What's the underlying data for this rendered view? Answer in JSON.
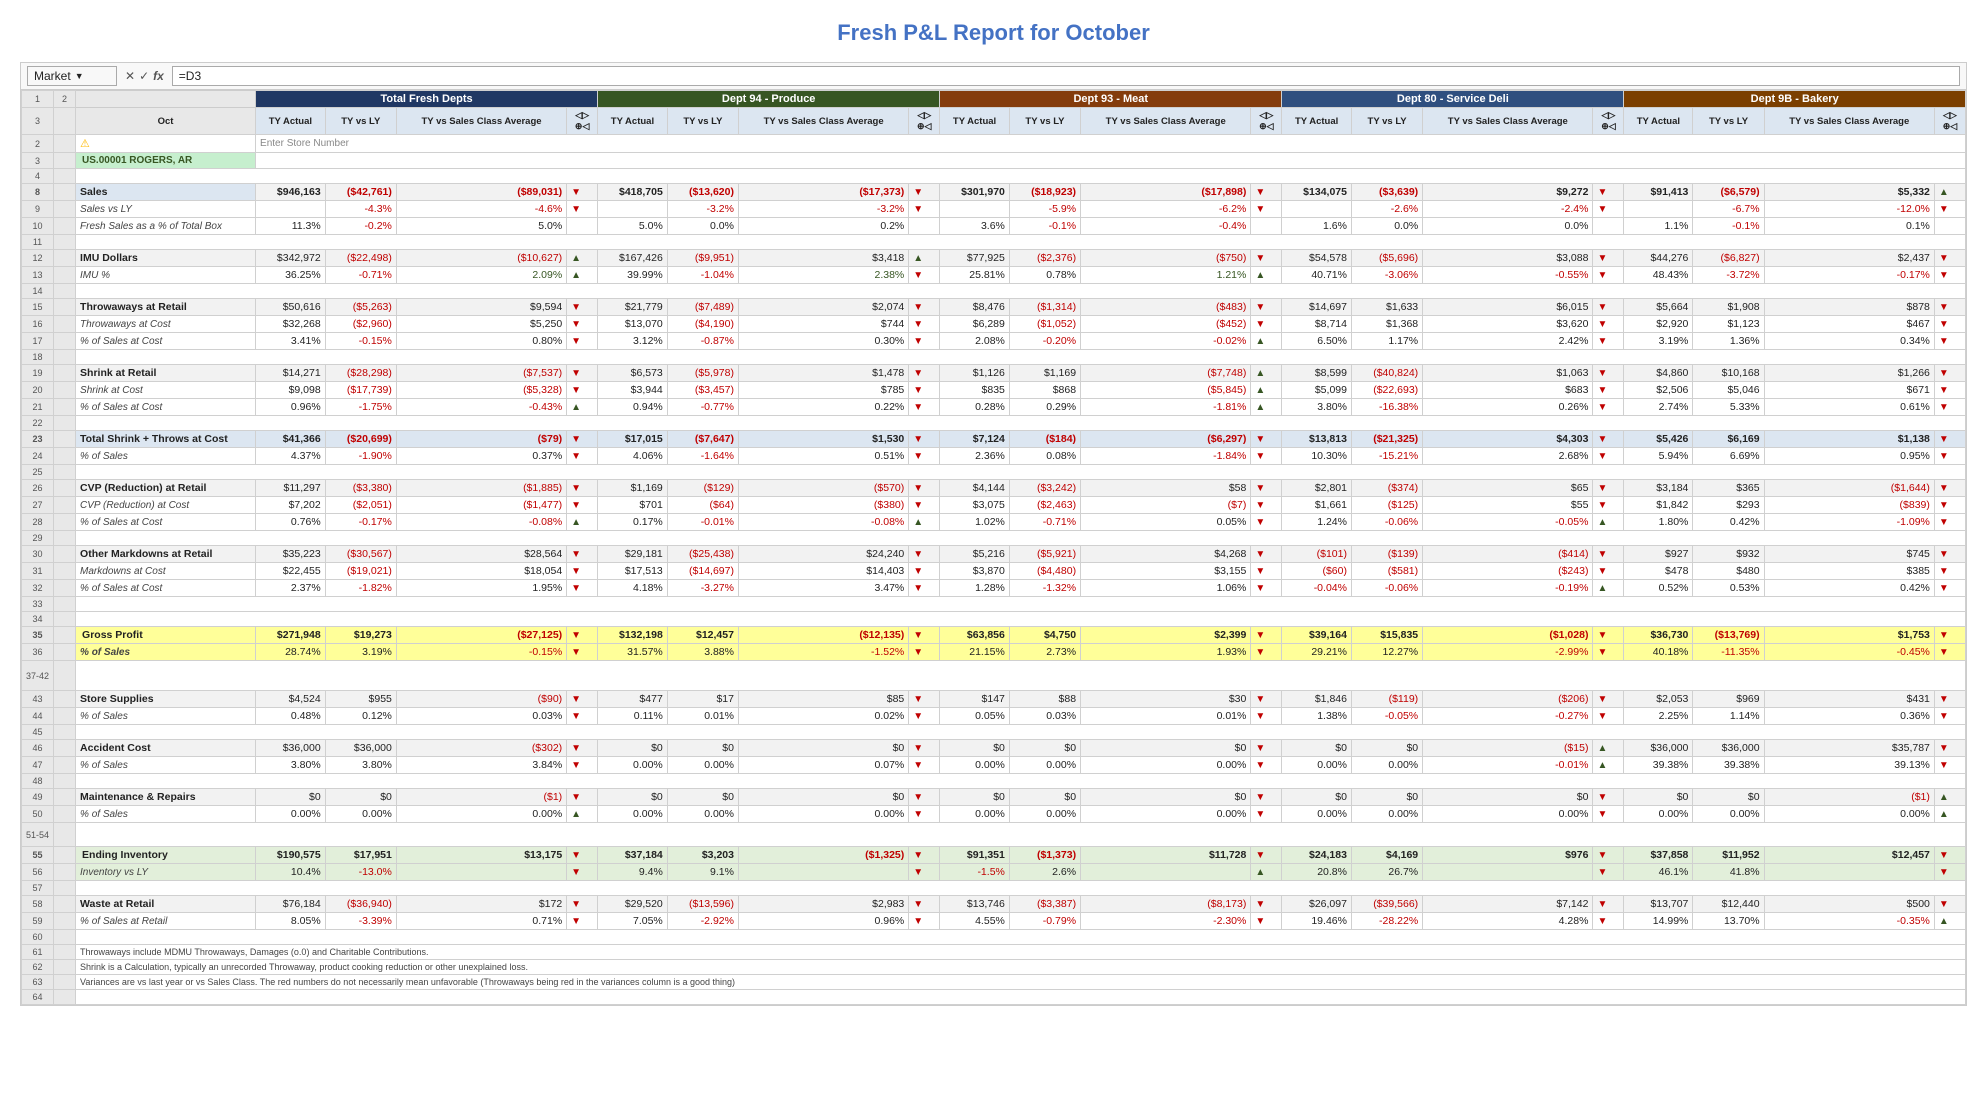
{
  "title": "Fresh P&L Report for October",
  "formula_bar": {
    "name_box": "Market",
    "formula": "=D3"
  },
  "store": "US.00001 ROGERS, AR",
  "col_month": "Oct",
  "sections": {
    "total_fresh": "Total Fresh Depts",
    "dept94": "Dept 94 - Produce",
    "dept93": "Dept 93 - Meat",
    "dept80": "Dept 80 - Service Deli",
    "dept98": "Dept 9B - Bakery"
  },
  "col_headers": [
    "TY Actual",
    "TY vs LY",
    "TY vs Sales Class Average",
    "▼"
  ],
  "rows": [
    {
      "rn": 8,
      "label": "Sales",
      "type": "section-hdr",
      "vals": [
        [
          "$946,163",
          "($42,761)",
          "($89,031)",
          "▼"
        ],
        [
          "$418,705",
          "($13,620)",
          "($17,373)",
          "▼"
        ],
        [
          "$301,970",
          "($18,923)",
          "($17,898)",
          "▼"
        ],
        [
          "$134,075",
          "($3,639)",
          "$9,272",
          "▼"
        ],
        [
          "$91,413",
          "($6,579)",
          "$5,332",
          "▲"
        ]
      ]
    },
    {
      "rn": 9,
      "label": "Sales vs LY",
      "type": "sub",
      "vals": [
        [
          "-4.3%",
          "-4.6%",
          "▼"
        ],
        [
          "-3.2%",
          "-3.2%",
          "▼"
        ],
        [
          "-5.9%",
          "-6.2%",
          "▼"
        ],
        [
          "-2.6%",
          "-2.4%",
          "▼"
        ],
        [
          "-6.7%",
          "-12.0%",
          "▼"
        ]
      ]
    },
    {
      "rn": 10,
      "label": "Fresh Sales as a % of Total Box",
      "type": "sub",
      "vals": [
        [
          "11.3%",
          "-0.2%",
          "5.0%"
        ],
        [
          "5.0%",
          "0.0%",
          "0.2%"
        ],
        [
          "3.6%",
          "-0.1%",
          "-0.4%"
        ],
        [
          "1.6%",
          "0.0%",
          "0.0%"
        ],
        [
          "1.1%",
          "-0.1%",
          "0.1%"
        ]
      ]
    },
    {
      "rn": 12,
      "label": "IMU Dollars",
      "type": "label",
      "vals": [
        [
          "$342,972",
          "($22,498)",
          "($10,627)",
          "▲"
        ],
        [
          "$167,426",
          "($9,951)",
          "$3,418",
          "▲"
        ],
        [
          "$77,925",
          "($2,376)",
          "($750)",
          "▼"
        ],
        [
          "$54,578",
          "($5,696)",
          "$3,088",
          "▼"
        ],
        [
          "$44,276",
          "($6,827)",
          "$2,437",
          "▼"
        ]
      ]
    },
    {
      "rn": 13,
      "label": "IMU %",
      "type": "sub",
      "vals": [
        [
          "36.25%",
          "-0.71%",
          "2.09%",
          "▲"
        ],
        [
          "39.99%",
          "-1.04%",
          "2.38%",
          "▼"
        ],
        [
          "25.81%",
          "0.78%",
          "1.21%",
          "▲"
        ],
        [
          "40.71%",
          "-3.06%",
          "-0.55%",
          "▼"
        ],
        [
          "48.43%",
          "-3.72%",
          "-0.17%",
          "▼"
        ]
      ]
    },
    {
      "rn": 15,
      "label": "Throwaways at Retail",
      "type": "label",
      "vals": [
        [
          "$50,616",
          "($5,263)",
          "$9,594",
          "▼"
        ],
        [
          "$21,779",
          "($7,489)",
          "$2,074",
          "▼"
        ],
        [
          "$8,476",
          "($1,314)",
          "($483)",
          "▼"
        ],
        [
          "$14,697",
          "$1,633",
          "$6,015",
          "▼"
        ],
        [
          "$5,664",
          "$1,908",
          "$878",
          "▼"
        ]
      ]
    },
    {
      "rn": 16,
      "label": "Throwaways at Cost",
      "type": "sub",
      "vals": [
        [
          "$32,268",
          "($2,960)",
          "$5,250",
          "▼"
        ],
        [
          "$13,070",
          "($4,190)",
          "$744",
          "▼"
        ],
        [
          "$6,289",
          "($1,052)",
          "($452)",
          "▼"
        ],
        [
          "$8,714",
          "$1,368",
          "$3,620",
          "▼"
        ],
        [
          "$2,920",
          "$1,123",
          "$467",
          "▼"
        ]
      ]
    },
    {
      "rn": 17,
      "label": "% of Sales at Cost",
      "type": "sub",
      "vals": [
        [
          "3.41%",
          "-0.15%",
          "0.80%",
          "▼"
        ],
        [
          "3.12%",
          "-0.87%",
          "0.30%",
          "▼"
        ],
        [
          "2.08%",
          "-0.20%",
          "-0.02%",
          "▲"
        ],
        [
          "6.50%",
          "1.17%",
          "2.42%",
          "▼"
        ],
        [
          "3.19%",
          "1.36%",
          "0.34%",
          "▼"
        ]
      ]
    },
    {
      "rn": 19,
      "label": "Shrink at Retail",
      "type": "label",
      "vals": [
        [
          "$14,271",
          "($28,298)",
          "($7,537)",
          "▼"
        ],
        [
          "$6,573",
          "($5,978)",
          "$1,478",
          "▼"
        ],
        [
          "$1,126",
          "$1,169",
          "($7,748)",
          "▲"
        ],
        [
          "$8,599",
          "($40,824)",
          "$1,063",
          "▼"
        ],
        [
          "$4,860",
          "$10,168",
          "$1,266",
          "▼"
        ]
      ]
    },
    {
      "rn": 20,
      "label": "Shrink at Cost",
      "type": "sub",
      "vals": [
        [
          "$9,098",
          "($17,739)",
          "($5,328)",
          "▼"
        ],
        [
          "$3,944",
          "($3,457)",
          "$785",
          "▼"
        ],
        [
          "$835",
          "$868",
          "($5,845)",
          "▲"
        ],
        [
          "$5,099",
          "($22,693)",
          "$683",
          "▼"
        ],
        [
          "$2,506",
          "$5,046",
          "$671",
          "▼"
        ]
      ]
    },
    {
      "rn": 21,
      "label": "% of Sales at Cost",
      "type": "sub",
      "vals": [
        [
          "0.96%",
          "-1.75%",
          "-0.43%",
          "▲"
        ],
        [
          "0.94%",
          "-0.77%",
          "0.22%",
          "▼"
        ],
        [
          "0.28%",
          "0.29%",
          "-1.81%",
          "▲"
        ],
        [
          "3.80%",
          "-16.38%",
          "0.26%",
          "▼"
        ],
        [
          "2.74%",
          "5.33%",
          "0.61%",
          "▼"
        ]
      ]
    },
    {
      "rn": 23,
      "label": "Total Shrink + Throws at Cost",
      "type": "total-row",
      "vals": [
        [
          "$41,366",
          "($20,699)",
          "($79)",
          "▼"
        ],
        [
          "$17,015",
          "($7,647)",
          "$1,530",
          "▼"
        ],
        [
          "$7,124",
          "($184)",
          "($6,297)",
          "▼"
        ],
        [
          "$13,813",
          "($21,325)",
          "$4,303",
          "▼"
        ],
        [
          "$5,426",
          "$6,169",
          "$1,138",
          "▼"
        ]
      ]
    },
    {
      "rn": 24,
      "label": "% of Sales",
      "type": "sub",
      "vals": [
        [
          "4.37%",
          "-1.90%",
          "0.37%",
          "▼"
        ],
        [
          "4.06%",
          "-1.64%",
          "0.51%",
          "▼"
        ],
        [
          "2.36%",
          "0.08%",
          "-1.84%",
          "▼"
        ],
        [
          "10.30%",
          "-15.21%",
          "2.68%",
          "▼"
        ],
        [
          "5.94%",
          "6.69%",
          "0.95%",
          "▼"
        ]
      ]
    },
    {
      "rn": 26,
      "label": "CVP (Reduction) at Retail",
      "type": "label",
      "vals": [
        [
          "$11,297",
          "($3,380)",
          "($1,885)",
          "▼"
        ],
        [
          "$1,169",
          "($129)",
          "($570)",
          "▼"
        ],
        [
          "$4,144",
          "($3,242)",
          "$58",
          "▼"
        ],
        [
          "$2,801",
          "($374)",
          "$65",
          "▼"
        ],
        [
          "$3,184",
          "$365",
          "($1,644)",
          "▼"
        ]
      ]
    },
    {
      "rn": 27,
      "label": "CVP (Reduction) at Cost",
      "type": "sub",
      "vals": [
        [
          "$7,202",
          "($2,051)",
          "($1,477)",
          "▼"
        ],
        [
          "$701",
          "($64)",
          "($380)",
          "▼"
        ],
        [
          "$3,075",
          "($2,463)",
          "($7)",
          "▼"
        ],
        [
          "$1,661",
          "($125)",
          "$55",
          "▼"
        ],
        [
          "$1,842",
          "$293",
          "($839)",
          "▼"
        ]
      ]
    },
    {
      "rn": 28,
      "label": "% of Sales at Cost",
      "type": "sub",
      "vals": [
        [
          "0.76%",
          "-0.17%",
          "-0.08%",
          "▲"
        ],
        [
          "0.17%",
          "-0.01%",
          "-0.08%",
          "▲"
        ],
        [
          "1.02%",
          "-0.71%",
          "0.05%",
          "▼"
        ],
        [
          "1.24%",
          "-0.06%",
          "-0.05%",
          "▲"
        ],
        [
          "1.80%",
          "0.42%",
          "-1.09%",
          "▼"
        ]
      ]
    },
    {
      "rn": 30,
      "label": "Other Markdowns at Retail",
      "type": "label",
      "vals": [
        [
          "$35,223",
          "($30,567)",
          "$28,564",
          "▼"
        ],
        [
          "$29,181",
          "($25,438)",
          "$24,240",
          "▼"
        ],
        [
          "$5,216",
          "($5,921)",
          "$4,268",
          "▼"
        ],
        [
          "($101)",
          "($139)",
          "($414)",
          "▼"
        ],
        [
          "$927",
          "$932",
          "$745",
          "▼"
        ]
      ]
    },
    {
      "rn": 31,
      "label": "Markdowns at Cost",
      "type": "sub",
      "vals": [
        [
          "$22,455",
          "($19,021)",
          "$18,054",
          "▼"
        ],
        [
          "$17,513",
          "($14,697)",
          "$14,403",
          "▼"
        ],
        [
          "$3,870",
          "($4,480)",
          "$3,155",
          "▼"
        ],
        [
          "($60)",
          "($581)",
          "($243)",
          "▼"
        ],
        [
          "$478",
          "$480",
          "$385",
          "▼"
        ]
      ]
    },
    {
      "rn": 32,
      "label": "% of Sales at Cost",
      "type": "sub",
      "vals": [
        [
          "2.37%",
          "-1.82%",
          "1.95%",
          "▼"
        ],
        [
          "4.18%",
          "-3.27%",
          "3.47%",
          "▼"
        ],
        [
          "1.28%",
          "-1.32%",
          "1.06%",
          "▼"
        ],
        [
          "-0.04%",
          "-0.06%",
          "-0.19%",
          "▲"
        ],
        [
          "0.52%",
          "0.53%",
          "0.42%",
          "▼"
        ]
      ]
    },
    {
      "rn": 35,
      "label": "Gross Profit",
      "type": "gross",
      "vals": [
        [
          "$271,948",
          "$19,273",
          "($27,125)",
          "▼"
        ],
        [
          "$132,198",
          "$12,457",
          "($12,135)",
          "▼"
        ],
        [
          "$63,856",
          "$4,750",
          "$2,399",
          "▼"
        ],
        [
          "$39,164",
          "$15,835",
          "($1,028)",
          "▼"
        ],
        [
          "$36,730",
          "($13,769)",
          "$1,753",
          "▼"
        ]
      ]
    },
    {
      "rn": 36,
      "label": "% of Sales",
      "type": "gross-sub",
      "vals": [
        [
          "28.74%",
          "3.19%",
          "-0.15%",
          "▼"
        ],
        [
          "31.57%",
          "3.88%",
          "-1.52%",
          "▼"
        ],
        [
          "21.15%",
          "2.73%",
          "1.93%",
          "▼"
        ],
        [
          "29.21%",
          "12.27%",
          "-2.99%",
          "▼"
        ],
        [
          "40.18%",
          "-11.35%",
          "-0.45%",
          "▼"
        ]
      ]
    },
    {
      "rn": 43,
      "label": "Store Supplies",
      "type": "label",
      "vals": [
        [
          "$4,524",
          "$955",
          "($90)",
          "▼"
        ],
        [
          "$477",
          "$17",
          "$85",
          "▼"
        ],
        [
          "$147",
          "$88",
          "$30",
          "▼"
        ],
        [
          "$1,846",
          "($119)",
          "($206)",
          "▼"
        ],
        [
          "$2,053",
          "$969",
          "$431",
          "▼"
        ]
      ]
    },
    {
      "rn": 44,
      "label": "% of Sales",
      "type": "sub",
      "vals": [
        [
          "0.48%",
          "0.12%",
          "0.03%",
          "▼"
        ],
        [
          "0.11%",
          "0.01%",
          "0.02%",
          "▼"
        ],
        [
          "0.05%",
          "0.03%",
          "0.01%",
          "▼"
        ],
        [
          "1.38%",
          "-0.05%",
          "-0.27%",
          "▼"
        ],
        [
          "2.25%",
          "1.14%",
          "0.36%",
          "▼"
        ]
      ]
    },
    {
      "rn": 46,
      "label": "Accident Cost",
      "type": "label",
      "vals": [
        [
          "$36,000",
          "$36,000",
          "($302)",
          "▼"
        ],
        [
          "$0",
          "$0",
          "$0",
          "▼"
        ],
        [
          "$0",
          "$0",
          "$0",
          "▼"
        ],
        [
          "$0",
          "$0",
          "($15)",
          "▲"
        ],
        [
          "$36,000",
          "$36,000",
          "$35,787",
          "▼"
        ]
      ]
    },
    {
      "rn": 47,
      "label": "% of Sales",
      "type": "sub",
      "vals": [
        [
          "3.80%",
          "3.80%",
          "3.84%",
          "▼"
        ],
        [
          "0.00%",
          "0.00%",
          "0.07%",
          "▼"
        ],
        [
          "0.00%",
          "0.00%",
          "0.00%",
          "▼"
        ],
        [
          "0.00%",
          "0.00%",
          "-0.01%",
          "▲"
        ],
        [
          "39.38%",
          "39.38%",
          "39.13%",
          "▼"
        ]
      ]
    },
    {
      "rn": 49,
      "label": "Maintenance & Repairs",
      "type": "label",
      "vals": [
        [
          "$0",
          "$0",
          "($1)",
          "▼"
        ],
        [
          "$0",
          "$0",
          "$0",
          "▼"
        ],
        [
          "$0",
          "$0",
          "$0",
          "▼"
        ],
        [
          "$0",
          "$0",
          "$0",
          "▼"
        ],
        [
          "$0",
          "$0",
          "($1)",
          "▲"
        ]
      ]
    },
    {
      "rn": 50,
      "label": "% of Sales",
      "type": "sub",
      "vals": [
        [
          "0.00%",
          "0.00%",
          "0.00%",
          "▲"
        ],
        [
          "0.00%",
          "0.00%",
          "0.00%",
          "▼"
        ],
        [
          "0.00%",
          "0.00%",
          "0.00%",
          "▼"
        ],
        [
          "0.00%",
          "0.00%",
          "0.00%",
          "▼"
        ],
        [
          "0.00%",
          "0.00%",
          "0.00%",
          "▲"
        ]
      ]
    },
    {
      "rn": 55,
      "label": "Ending Inventory",
      "type": "ending",
      "vals": [
        [
          "$190,575",
          "$17,951",
          "$13,175",
          "▼"
        ],
        [
          "$37,184",
          "$3,203",
          "($1,325)",
          "▼"
        ],
        [
          "$91,351",
          "($1,373)",
          "$11,728",
          "▼"
        ],
        [
          "$24,183",
          "$4,169",
          "$976",
          "▼"
        ],
        [
          "$37,858",
          "$11,952",
          "$12,457",
          "▼"
        ]
      ]
    },
    {
      "rn": 56,
      "label": "Inventory vs LY",
      "type": "sub",
      "vals": [
        [
          "10.4%",
          "-13.0%",
          "▼"
        ],
        [
          "9.4%",
          "9.1%",
          "▼"
        ],
        [
          "-1.5%",
          "2.6%",
          "▲"
        ],
        [
          "20.8%",
          "26.7%",
          "▼"
        ],
        [
          "46.1%",
          "41.8%",
          "▼"
        ]
      ]
    },
    {
      "rn": 58,
      "label": "Waste at Retail",
      "type": "label",
      "vals": [
        [
          "$76,184",
          "($36,940)",
          "$172",
          "▼"
        ],
        [
          "$29,520",
          "($13,596)",
          "$2,983",
          "▼"
        ],
        [
          "$13,746",
          "($3,387)",
          "($8,173)",
          "▼"
        ],
        [
          "$26,097",
          "($39,566)",
          "$7,142",
          "▼"
        ],
        [
          "$13,707",
          "$12,440",
          "$500",
          "▼"
        ]
      ]
    },
    {
      "rn": 59,
      "label": "% of Sales at Retail",
      "type": "sub",
      "vals": [
        [
          "8.05%",
          "-3.39%",
          "0.71%",
          "▼"
        ],
        [
          "7.05%",
          "-2.92%",
          "0.96%",
          "▼"
        ],
        [
          "4.55%",
          "-0.79%",
          "-2.30%",
          "▼"
        ],
        [
          "19.46%",
          "-28.22%",
          "4.28%",
          "▼"
        ],
        [
          "14.99%",
          "13.70%",
          "-0.35%",
          "▲"
        ]
      ]
    }
  ],
  "notes": [
    "61  Throwaways include MDMU Throwaways, Damages (o.0) and Charitable Contributions.",
    "62  Shrink is a Calculation, typically an unrecorded Throwaway, product cooking reduction or other unexplained loss.",
    "63  Variances are vs last year or vs Sales Class. The red numbers do not necessarily mean unfavorable (Throwaways being red in the variances column is a good thing)"
  ]
}
